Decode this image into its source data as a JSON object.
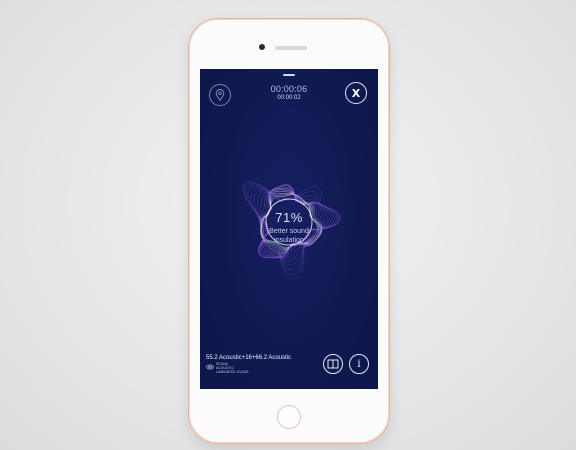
{
  "timer": {
    "elapsed": "00:00:06",
    "sub": "00:00:02"
  },
  "result": {
    "percent": "71%",
    "caption": "Better sound insulation"
  },
  "product": {
    "name": "55.2 Acoustic+16+66.2 Acoustic",
    "brand_lines": [
      "SIGNIA",
      "ACOUSTIC",
      "LAMINATED GLASS"
    ]
  },
  "buttons": {
    "close_label": "X",
    "info_label": "i"
  },
  "icons": {
    "location": "location-pin-icon",
    "book": "book-icon",
    "info": "info-icon",
    "close": "close-icon"
  },
  "colors": {
    "screen_bg": "#101a52",
    "wave_purple": "#a15cf2",
    "wave_white": "#ffffff",
    "phone_trim": "#e7b8a0"
  }
}
